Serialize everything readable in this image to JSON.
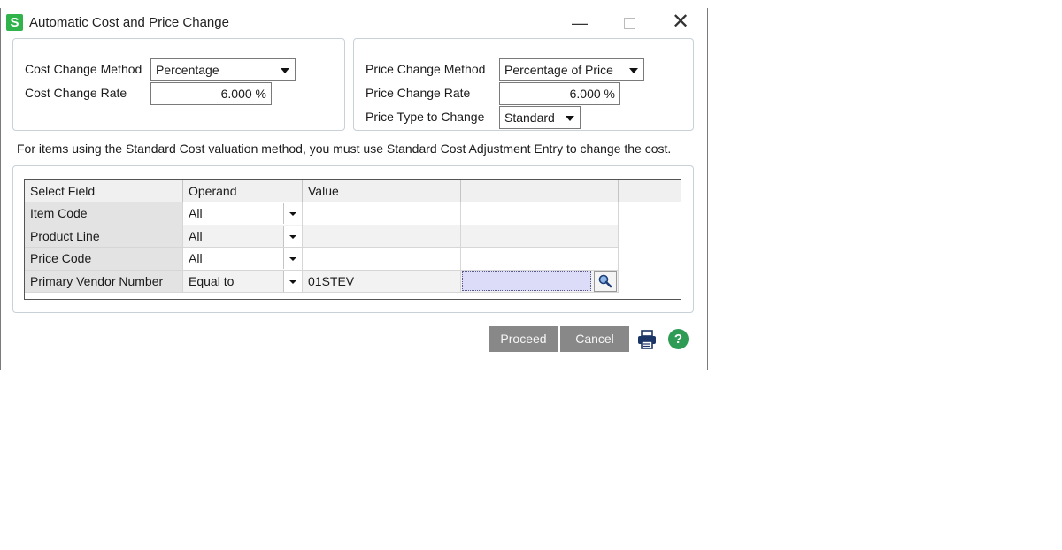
{
  "window": {
    "title": "Automatic Cost and Price Change",
    "logo_letter": "S",
    "minimize": "—",
    "close": "✕"
  },
  "cost": {
    "method_label": "Cost Change Method",
    "method_value": "Percentage",
    "rate_label": "Cost Change Rate",
    "rate_value": "6.000 %"
  },
  "price": {
    "method_label": "Price Change Method",
    "method_value": "Percentage of Price",
    "rate_label": "Price Change Rate",
    "rate_value": "6.000 %",
    "type_label": "Price Type to Change",
    "type_value": "Standard"
  },
  "info_text": "For items using the Standard Cost valuation method, you must use Standard Cost Adjustment Entry to change the cost.",
  "grid": {
    "headers": [
      "Select Field",
      "Operand",
      "Value",
      ""
    ],
    "rows": [
      {
        "field": "Item Code",
        "operand": "All",
        "value": ""
      },
      {
        "field": "Product Line",
        "operand": "All",
        "value": ""
      },
      {
        "field": "Price Code",
        "operand": "All",
        "value": ""
      },
      {
        "field": "Primary Vendor Number",
        "operand": "Equal to",
        "value": "01STEV"
      }
    ]
  },
  "buttons": {
    "proceed": "Proceed",
    "cancel": "Cancel",
    "help": "?"
  },
  "colors": {
    "accent_green": "#2fb34a",
    "button_gray": "#888888",
    "lookup_field": "#dcdcf8"
  },
  "icons": [
    "app-logo-icon",
    "print-icon",
    "help-icon",
    "lookup-icon",
    "dropdown-arrow-icon"
  ]
}
